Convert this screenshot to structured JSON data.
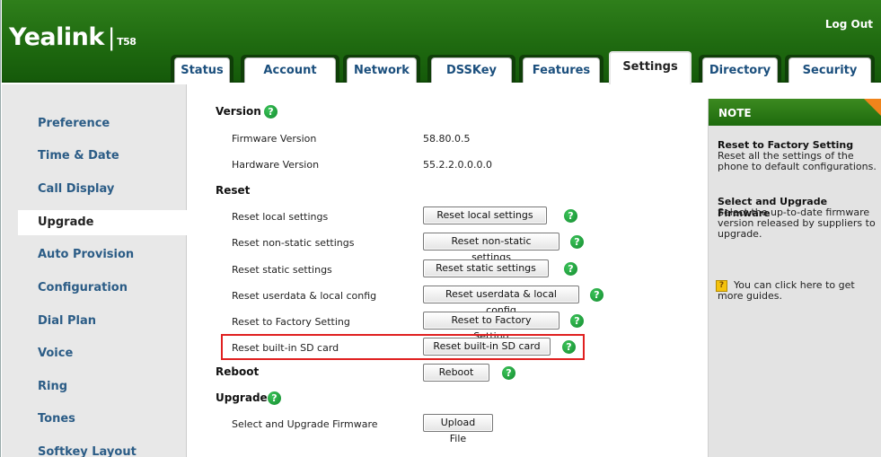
{
  "header": {
    "logo": "Yealink",
    "logo_separator": "|",
    "model": "T58",
    "logout_label": "Log Out",
    "tabs": [
      {
        "label": "Status"
      },
      {
        "label": "Account"
      },
      {
        "label": "Network"
      },
      {
        "label": "DSSKey"
      },
      {
        "label": "Features"
      },
      {
        "label": "Settings",
        "active": true
      },
      {
        "label": "Directory"
      },
      {
        "label": "Security"
      }
    ]
  },
  "sidebar": {
    "items": [
      {
        "label": "Preference"
      },
      {
        "label": "Time & Date"
      },
      {
        "label": "Call Display"
      },
      {
        "label": "Upgrade",
        "active": true
      },
      {
        "label": "Auto Provision"
      },
      {
        "label": "Configuration"
      },
      {
        "label": "Dial Plan"
      },
      {
        "label": "Voice"
      },
      {
        "label": "Ring"
      },
      {
        "label": "Tones"
      },
      {
        "label": "Softkey Layout"
      }
    ]
  },
  "main": {
    "version": {
      "title": "Version",
      "firmware_label": "Firmware Version",
      "firmware_value": "58.80.0.5",
      "hardware_label": "Hardware Version",
      "hardware_value": "55.2.2.0.0.0.0"
    },
    "reset": {
      "title": "Reset",
      "rows": [
        {
          "label": "Reset local settings",
          "button": "Reset local settings"
        },
        {
          "label": "Reset non-static settings",
          "button": "Reset non-static settings"
        },
        {
          "label": "Reset static settings",
          "button": "Reset static settings"
        },
        {
          "label": "Reset userdata & local config",
          "button": "Reset userdata & local config"
        },
        {
          "label": "Reset to Factory Setting",
          "button": "Reset to Factory Setting"
        },
        {
          "label": "Reset built-in SD card",
          "button": "Reset built-in SD card"
        }
      ]
    },
    "reboot": {
      "title": "Reboot",
      "button": "Reboot"
    },
    "upgrade": {
      "title": "Upgrade",
      "firmware_label": "Select and Upgrade Firmware",
      "button": "Upload File"
    },
    "help_glyph": "?"
  },
  "note": {
    "title": "NOTE",
    "sections": [
      {
        "heading": "Reset to Factory Setting",
        "text": "Reset all the settings of the phone to default configurations."
      },
      {
        "heading": "Select and Upgrade Firmware",
        "text": "Select the up-to-date firmware version released by suppliers to upgrade."
      }
    ],
    "guide_text": "You can click here to get more guides.",
    "guide_icon": "book-icon"
  },
  "colors": {
    "header_green": "#1f6a10",
    "link_blue": "#2b5c86",
    "highlight_red": "#e02020",
    "note_accent": "#f0841b"
  }
}
